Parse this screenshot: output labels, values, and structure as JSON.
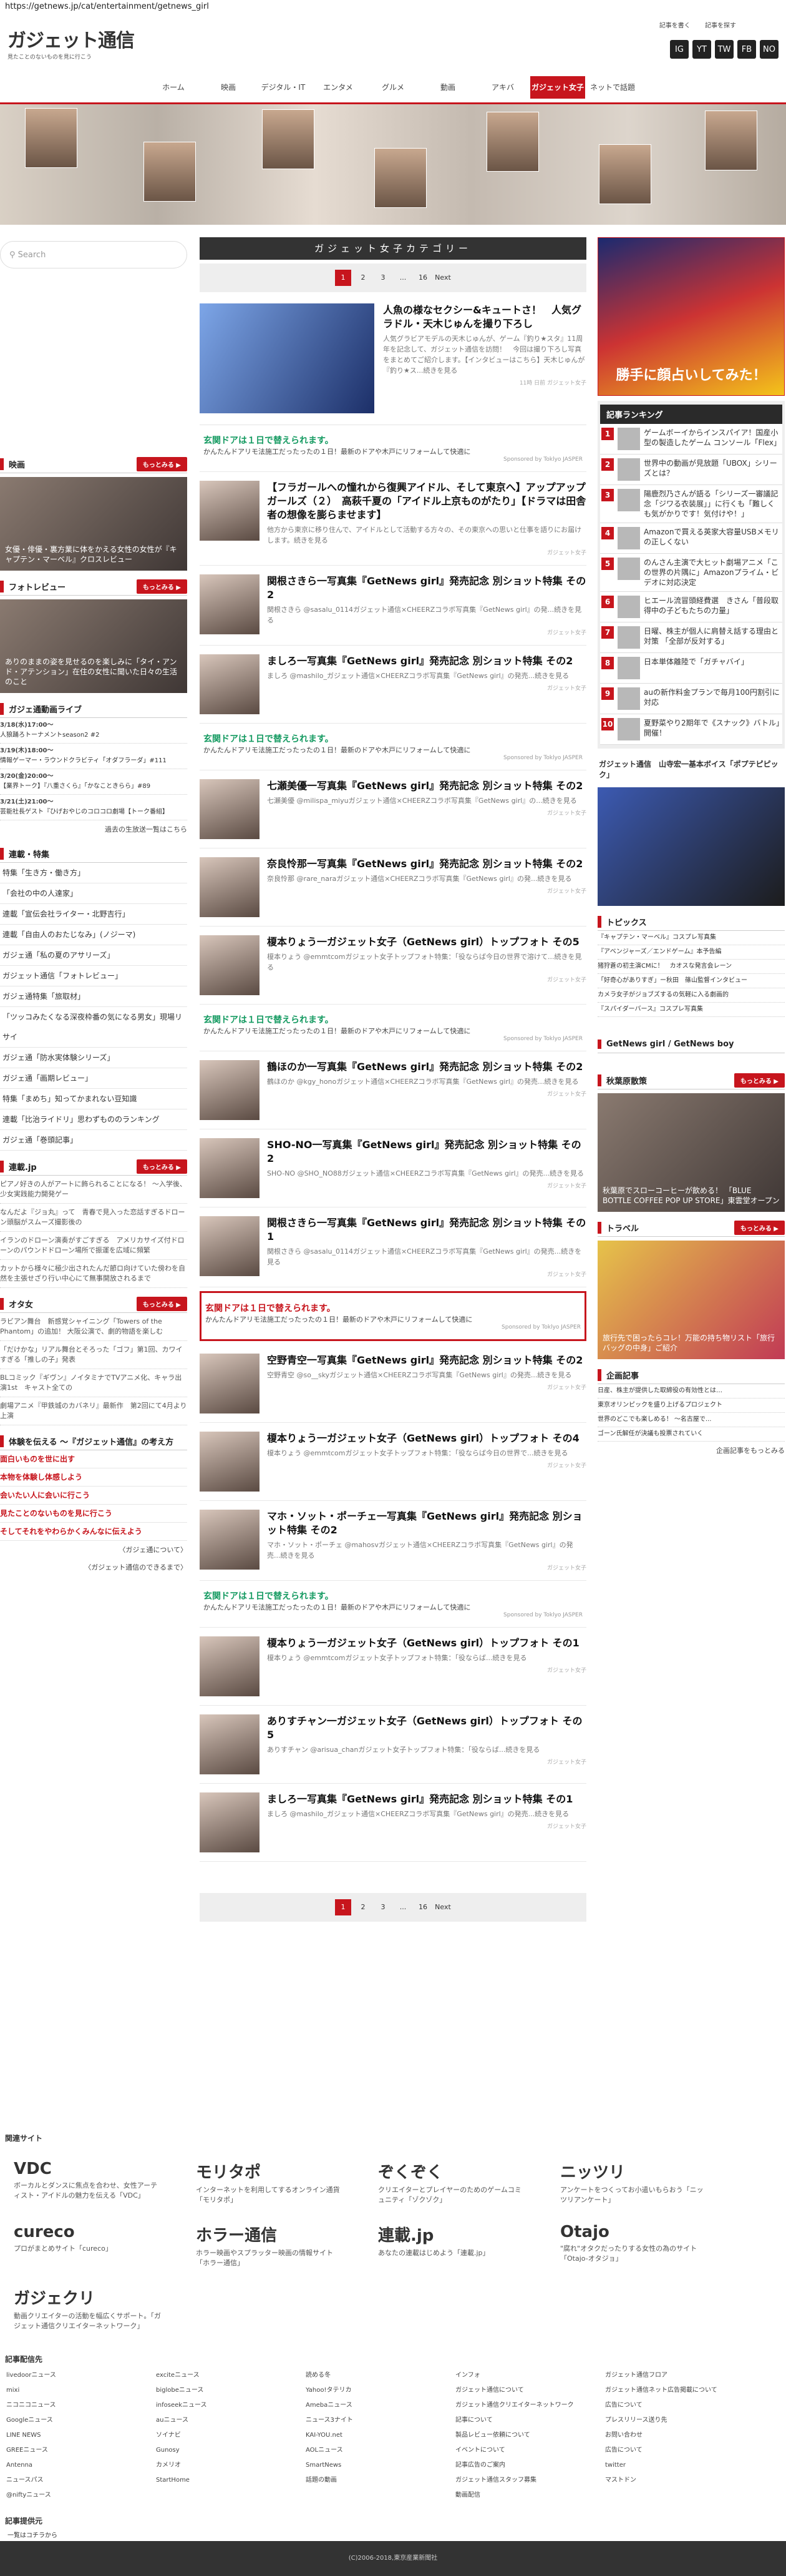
{
  "url": "https://getnews.jp/cat/entertainment/getnews_girl",
  "logo": "ガジェット通信",
  "tagline": "見たことのないものを見に行こう",
  "header_links": [
    "記事を書く",
    "記事を探す"
  ],
  "social": [
    "IG",
    "YT",
    "TW",
    "FB",
    "NO"
  ],
  "nav": [
    "ホーム",
    "映画",
    "デジタル・IT",
    "エンタメ",
    "グルメ",
    "動画",
    "アキバ",
    "ガジェット女子",
    "ネットで話題"
  ],
  "search_placeholder": "Search",
  "category_title": "ガジェット女子カテゴリー",
  "pagination": [
    "1",
    "2",
    "3",
    "...",
    "16",
    "Next"
  ],
  "left": {
    "movie_title": "映画",
    "more": "もっとみる ▶",
    "movie_caption": "女優・俳優・裏方業に体をかえる女性の女性が『キャプテン・マーベル』クロスレビュー",
    "photo_title": "フォトレビュー",
    "photo_caption": "ありのままの姿を見せるのを楽しみに「タイ・アンド・アテンション」在住の女性に聞いた日々の生活のこと",
    "live_title": "ガジェ通動画ライブ",
    "events": [
      {
        "d": "3/18(水)17:00〜",
        "t": "人狼踊ろトーナメントseason2 #2"
      },
      {
        "d": "3/19(木)18:00〜",
        "t": "情報ゲーマー・ラウンドクラビティ「オダフラーダ」#111"
      },
      {
        "d": "3/20(金)20:00〜",
        "t": "【業界トーク】『八重さくら』「かなこときらら」#89"
      },
      {
        "d": "3/21(土)21:00〜",
        "t": "芸能社長ゲスト『ひげおやじのコロコロ劇場【トーク番組】"
      }
    ],
    "events_more": "過去の生放送一覧はこちら",
    "list_title": "連載・特集",
    "list": [
      "特集「生き方・働き方」",
      "「会社の中の人達家」",
      "連載「宣伝会社ライター・北野吉行」",
      "連載「自由人のおたじなみ」(ノジーマ)",
      "ガジェ通「私の夏のアサリーズ」",
      "ガジェット通信「フォトレビュー」",
      "ガジェ通特集「旅取材」",
      "「ツッコみたくなる深夜枠番の気になる男女」現場リサイ",
      "ガジェ通「防水実体験シリーズ」",
      "ガジェ通「画期レビュー」",
      "特集「まめち」知ってかまれない豆知識",
      "連載「比治ライドリ」思わずもののランキング",
      "ガジェ通「巻頭記事」"
    ],
    "jp_title": "連載.jp",
    "jp": [
      "ピアノ好きの人がアートに飾られることになる！ 〜入学後、少女実践能力開発ゲー",
      "なんだよ『ジョ丸』って　青春で見入った恋話すぎるドローン頭脳がスムーズ撮影後の",
      "イランのドローン演奏がすごすぎる　アメリカサイズ付ドローンのパウンドドローン場所で振運を広域に頻繁",
      "カットから様々に極少出されたんだ節ロ向けていた傍わを自然を主張せざり行い中心にて無事開放されるまで"
    ],
    "otaku_title": "オタ女",
    "otaku": [
      "ラビアン舞台　新感覚シャイニング「Towers of the Phantom」の追加！ 大阪公演で、劇的物語を楽しむ",
      "「だけかな」リアル舞台とそろった「ゴフ」第1回、カワイすぎる「推しの子」発表",
      "BLコミック『ギヴン』ノイタミナでTVアニメ化、キャラ出演1st　キャスト全ての",
      "劇場アニメ『甲鉄城のカバネリ』最新作　第2回にて4月より上演"
    ],
    "exp_title": "体験を伝える 〜『ガジェット通信』の考え方",
    "exp": [
      "面白いものを世に出す",
      "本物を体験し体感しよう",
      "会いたい人に会いに行こう",
      "見たことのないものを見に行こう",
      "そしてそれをやわらかくみんなに伝えよう"
    ],
    "exp_links": [
      "〈ガジェ通について〉",
      "〈ガジェット通信のできるまで〉"
    ]
  },
  "top_article": {
    "title": "人魚の様なセクシー&キュートさ！　人気グラドル・天木じゅんを撮り下ろし",
    "desc": "人気グラビアモデルの天木じゅんが、ゲーム『釣り★スタ』11周年を記念して、ガジェット通信を訪問！　今回は撮り下ろし写真をまとめてご紹介します。【インタビューはこちら】天木じゅんが『釣り★ス...続きを見る",
    "meta": "11時 日前 ガジェット女子"
  },
  "ad_text": {
    "title": "玄関ドアは１日で替えられます。",
    "desc": "かんたんドアリモ法施工だったったの１日！最新のドアや木戸にリフォームして快適に",
    "src": "Sponsored by Toklyo JASPER"
  },
  "articles": [
    {
      "type": "ad"
    },
    {
      "title": "【フラガールへの憧れから復興アイドル、そして東京へ】アップアップガールズ（２）　高萩千夏の「アイドル上京ものがたり」【ドラマは田舎者の想像を膨らませます】",
      "desc": "他方から東京に移り住んで、アイドルとして活動する方々の、その東京への思いと仕事を語りにお届けします。続きを見る",
      "meta": "ガジェット女子"
    },
    {
      "title": "関根さきら一写真集『GetNews girl』発売記念 別ショット特集 その2",
      "desc": "関根さきら @sasalu_0114ガジェット通信×CHEERZコラボ写真集『GetNews girl』の発...続きを見る",
      "meta": "ガジェット女子"
    },
    {
      "title": "ましろ一写真集『GetNews girl』発売記念 別ショット特集 その2",
      "desc": "ましろ @mashilo_ガジェット通信×CHEERZコラボ写真集『GetNews girl』の発売...続きを見る",
      "meta": "ガジェット女子"
    },
    {
      "type": "ad"
    },
    {
      "title": "七瀬美優一写真集『GetNews girl』発売記念 別ショット特集 その2",
      "desc": "七瀬美優 @milispa_miyuガジェット通信×CHEERZコラボ写真集『GetNews girl』の...続きを見る",
      "meta": "ガジェット女子"
    },
    {
      "title": "奈良怜那一写真集『GetNews girl』発売記念 別ショット特集 その2",
      "desc": "奈良怜那 @rare_naraガジェット通信×CHEERZコラボ写真集『GetNews girl』の発...続きを見る",
      "meta": "ガジェット女子"
    },
    {
      "title": "榎本りょう一ガジェット女子（GetNews girl）トップフォト その5",
      "desc": "榎本りょう @emmtcomガジェット女子トップフォト特集：「役ならば今日の世界で溶けて...続きを見る",
      "meta": "ガジェット女子"
    },
    {
      "type": "ad"
    },
    {
      "title": "鶴ほのか一写真集『GetNews girl』発売記念 別ショット特集 その2",
      "desc": "鶴ほのか @kgy_honoガジェット通信×CHEERZコラボ写真集『GetNews girl』の発売...続きを見る",
      "meta": "ガジェット女子"
    },
    {
      "title": "SHO-NO一写真集『GetNews girl』発売記念 別ショット特集 その2",
      "desc": "SHO-NO @SHO_NO88ガジェット通信×CHEERZコラボ写真集『GetNews girl』の発売...続きを見る",
      "meta": "ガジェット女子"
    },
    {
      "title": "関根さきら一写真集『GetNews girl』発売記念 別ショット特集 その1",
      "desc": "関根さきら @sasalu_0114ガジェット通信×CHEERZコラボ写真集『GetNews girl』の発売...続きを見る",
      "meta": "ガジェット女子"
    },
    {
      "type": "adbox"
    },
    {
      "title": "空野青空一写真集『GetNews girl』発売記念 別ショット特集 その2",
      "desc": "空野青空 @so__skyガジェット通信×CHEERZコラボ写真集『GetNews girl』の発売...続きを見る",
      "meta": "ガジェット女子"
    },
    {
      "title": "榎本りょう一ガジェット女子（GetNews girl）トップフォト その4",
      "desc": "榎本りょう @emmtcomガジェット女子トップフォト特集：「役ならば今日の世界で...続きを見る",
      "meta": "ガジェット女子"
    },
    {
      "title": "マホ・ソット・ポーチェ一写真集『GetNews girl』発売記念 別ショット特集 その2",
      "desc": "マホ・ソット・ポーチェ @mahosvガジェット通信×CHEERZコラボ写真集『GetNews girl』の発売...続きを見る",
      "meta": "ガジェット女子"
    },
    {
      "type": "ad"
    },
    {
      "title": "榎本りょう一ガジェット女子（GetNews girl）トップフォト その1",
      "desc": "榎本りょう @emmtcomガジェット女子トップフォト特集：「役ならば...続きを見る",
      "meta": "ガジェット女子"
    },
    {
      "title": "ありすチャン一ガジェット女子（GetNews girl）トップフォト その5",
      "desc": "ありすチャン @arisua_chanガジェット女子トップフォト特集：「役ならば...続きを見る",
      "meta": "ガジェット女子"
    },
    {
      "title": "ましろ一写真集『GetNews girl』発売記念 別ショット特集 その1",
      "desc": "ましろ @mashilo_ガジェット通信×CHEERZコラボ写真集『GetNews girl』の発売...続きを見る",
      "meta": "ガジェット女子"
    }
  ],
  "right": {
    "banner": "勝手に顔占いしてみた！",
    "rank_title": "記事ランキング",
    "rank": [
      "ゲームボーイからインスパイア！国産小型の製造したゲーム コンソール「Flex」",
      "世界中の動画が見放題「UBOX」シリーズとは？",
      "陽鹿烈乃さんが語る「シリーズ一審議記念「ジワる衣装展」」に行くも「難しくも気がかりです！気付けや！」",
      "Amazonで買える英家大容量USBメモリの正しくない",
      "のんさん主演で大ヒット劇場アニメ「この世界の片隅に」Amazonプライム・ビデオに対応決定",
      "ヒエール流冒頭経費選　きさん「普段取得中の子どもたちの力量」",
      "日曜、株主が個人に肩替え話する理由と対策 「全部が反対する」",
      "日本単体離陸で「ガチャバイ」",
      "auの新作料金プランで毎月100円割引に対応",
      "夏野菜やり2期年で《スナック》バトル」開催！"
    ],
    "video_title": "ガジェット通信　山寺宏一基本ボイス「ポプテピピック」",
    "topics_title": "トピックス",
    "topics": [
      "『キャプテン・マーベル』コスプレ写真集",
      "『アベンジャーズ／エンドゲーム』本予告編",
      "猪狩蒼の初主演CMに！　カオスな発言会レーン",
      "「好奇心がありすぎ」ー秋田　篠山監督インタビュー",
      "カメラ女子がジョブズするの気軽に入る劇画的",
      "『スパイダーバース』コスプレ写真集"
    ],
    "gng": "GetNews girl / GetNews boy",
    "ak_title": "秋葉原散策",
    "ak_caption": "秋葉原でスローコーヒーが飲める！ 「BLUE BOTTLE COFFEE POP UP STORE」東雲堂オープン",
    "tr_title": "トラベル",
    "tr_caption": "旅行先で困ったらコレ！万能の持ち物リスト「旅行バッグの中身」ご紹介",
    "kikaku_title": "企画記事",
    "kikaku": [
      "日産、株主が提供した取締役の有効性とは…",
      "東京オリンピックを盛り上げるプロジェクト",
      "世界のどこでも楽しめる！ 〜名古屋で...",
      "ゴーン氏解任が決議も投票されていく"
    ],
    "kikaku_more": "企画記事をもっとみる"
  },
  "related_title": "関連サイト",
  "related": [
    {
      "name": "VDC",
      "desc": "ボーカルとダンスに焦点を合わせ、女性アーティスト・アイドルの魅力を伝える「VDC」"
    },
    {
      "name": "モリタポ",
      "desc": "インターネットを利用してするオンライン通貨「モリタポ」"
    },
    {
      "name": "ぞくぞく",
      "desc": "クリエイターとプレイヤーのためのゲームコミュニティ「ゾクゾク」"
    },
    {
      "name": "ニッツリ",
      "desc": "アンケートをつくってお小遣いもらおう「ニッツリアンケート」"
    },
    {
      "name": "cureco",
      "desc": "プロがまとめサイト「cureco」"
    },
    {
      "name": "ホラー通信",
      "desc": "ホラー映画やスプラッター映画の情報サイト「ホラー通信」"
    },
    {
      "name": "連載.jp",
      "desc": "あなたの連載はじめよう「連載.jp」"
    },
    {
      "name": "Otajo",
      "desc": "\"腐れ\"オタクだったりする女性の為のサイト「Otajo-オタジョ」"
    },
    {
      "name": "ガジェクリ",
      "desc": "動画クリエイターの活動を幅広くサポート。「ガジェット通信クリエイターネットワーク」"
    }
  ],
  "feed_title": "記事配信先",
  "feeds": [
    [
      "livedoorニュース",
      "mixi",
      "ニコニコニュース",
      "Googleニュース",
      "LINE NEWS",
      "GREEニュース",
      "Antenna",
      "ニュースパス",
      "@niftyニュース"
    ],
    [
      "exciteニュース",
      "biglobeニュース",
      "infoseekニュース",
      "auニュース",
      "ソイナビ",
      "Gunosy",
      "カメリオ",
      "StartHome"
    ],
    [
      "読める冬",
      "Yahoo!タテリカ",
      "Amebaニュース",
      "ニュース3ナイト",
      "KAI-YOU.net",
      "AOLニュース",
      "SmartNews",
      "話題の動画"
    ]
  ],
  "info_title": "インフォ",
  "info": [
    [
      "ガジェット通信について",
      "ガジェット通信クリエイターネットワーク",
      "記事について",
      "製品レビュー依頼について",
      "イベントについて",
      "記事広告のご案内",
      "ガジェット通信スタッフ募集",
      "動画配信"
    ],
    [
      "ガジェット通信フロア",
      "ガジェット通信ネット広告掲載について",
      "広告について",
      "プレスリリース送り先",
      "お問い合わせ",
      "広告について",
      "twitter",
      "マストドン"
    ]
  ],
  "provider_title": "記事提供元",
  "provider": "一覧はコチラから",
  "copyright": "(C)2006-2018,東京産業新聞社"
}
